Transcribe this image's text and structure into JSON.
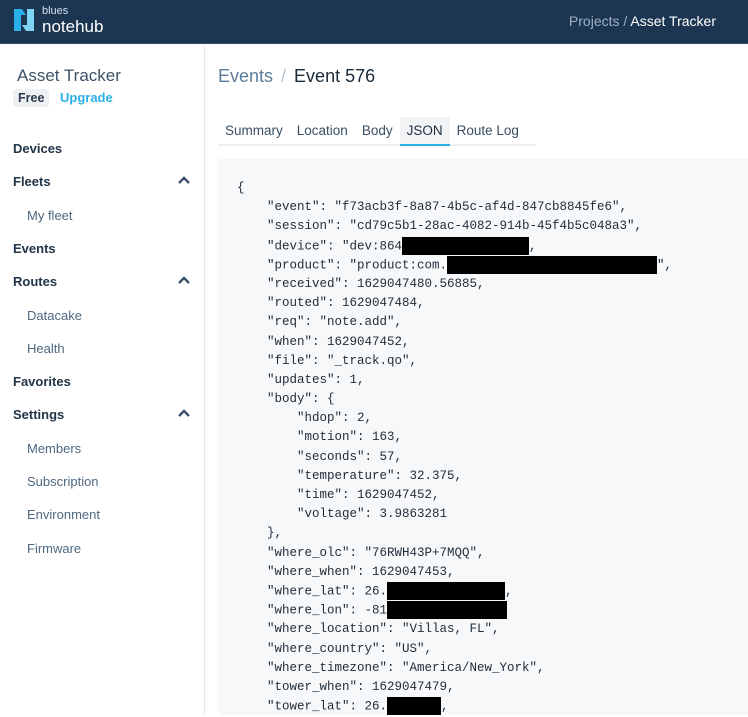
{
  "header": {
    "brand_small": "blues",
    "brand_big": "notehub",
    "crumb_parent": "Projects",
    "crumb_sep": " / ",
    "crumb_current": "Asset Tracker"
  },
  "sidebar": {
    "project": "Asset Tracker",
    "plan": "Free",
    "upgrade": "Upgrade",
    "items": [
      {
        "label": "Devices",
        "sub": false,
        "expanded": false
      },
      {
        "label": "Fleets",
        "sub": false,
        "expanded": true
      },
      {
        "label": "My fleet",
        "sub": true
      },
      {
        "label": "Events",
        "sub": false,
        "expanded": false
      },
      {
        "label": "Routes",
        "sub": false,
        "expanded": true
      },
      {
        "label": "Datacake",
        "sub": true
      },
      {
        "label": "Health",
        "sub": true
      },
      {
        "label": "Favorites",
        "sub": false,
        "expanded": false
      },
      {
        "label": "Settings",
        "sub": false,
        "expanded": true
      },
      {
        "label": "Members",
        "sub": true
      },
      {
        "label": "Subscription",
        "sub": true
      },
      {
        "label": "Environment",
        "sub": true
      },
      {
        "label": "Firmware",
        "sub": true
      }
    ]
  },
  "breadcrumb": {
    "parent": "Events",
    "sep": "/",
    "current": "Event 576"
  },
  "tabs": [
    {
      "label": "Summary"
    },
    {
      "label": "Location"
    },
    {
      "label": "Body"
    },
    {
      "label": "JSON",
      "active": true
    },
    {
      "label": "Route Log"
    }
  ],
  "json_lines": [
    {
      "i": 0,
      "t": "{"
    },
    {
      "i": 1,
      "t": "\"event\": \"f73acb3f-8a87-4b5c-af4d-847cb8845fe6\","
    },
    {
      "i": 1,
      "t": "\"session\": \"cd79c5b1-28ac-4082-914b-45f4b5c048a3\","
    },
    {
      "i": 1,
      "t": "\"device\": \"dev:864",
      "redacted": true,
      "after": ","
    },
    {
      "i": 1,
      "t": "\"product\": \"product:com.",
      "redacted": true,
      "after": "\","
    },
    {
      "i": 1,
      "t": "\"received\": 1629047480.56885,"
    },
    {
      "i": 1,
      "t": "\"routed\": 1629047484,"
    },
    {
      "i": 1,
      "t": "\"req\": \"note.add\","
    },
    {
      "i": 1,
      "t": "\"when\": 1629047452,"
    },
    {
      "i": 1,
      "t": "\"file\": \"_track.qo\","
    },
    {
      "i": 1,
      "t": "\"updates\": 1,"
    },
    {
      "i": 1,
      "t": "\"body\": {"
    },
    {
      "i": 2,
      "t": "\"hdop\": 2,"
    },
    {
      "i": 2,
      "t": "\"motion\": 163,"
    },
    {
      "i": 2,
      "t": "\"seconds\": 57,"
    },
    {
      "i": 2,
      "t": "\"temperature\": 32.375,"
    },
    {
      "i": 2,
      "t": "\"time\": 1629047452,"
    },
    {
      "i": 2,
      "t": "\"voltage\": 3.9863281"
    },
    {
      "i": 1,
      "t": "},"
    },
    {
      "i": 1,
      "t": "\"where_olc\": \"76RWH43P+7MQQ\","
    },
    {
      "i": 1,
      "t": "\"where_when\": 1629047453,"
    },
    {
      "i": 1,
      "t": "\"where_lat\": 26.",
      "redacted": true,
      "after": ","
    },
    {
      "i": 1,
      "t": "\"where_lon\": -81",
      "redacted": true,
      "after": ""
    },
    {
      "i": 1,
      "t": "\"where_location\": \"Villas, FL\","
    },
    {
      "i": 1,
      "t": "\"where_country\": \"US\","
    },
    {
      "i": 1,
      "t": "\"where_timezone\": \"America/New_York\","
    },
    {
      "i": 1,
      "t": "\"tower_when\": 1629047479,"
    },
    {
      "i": 1,
      "t": "\"tower_lat\": 26.",
      "redacted": true,
      "after": ","
    }
  ]
}
